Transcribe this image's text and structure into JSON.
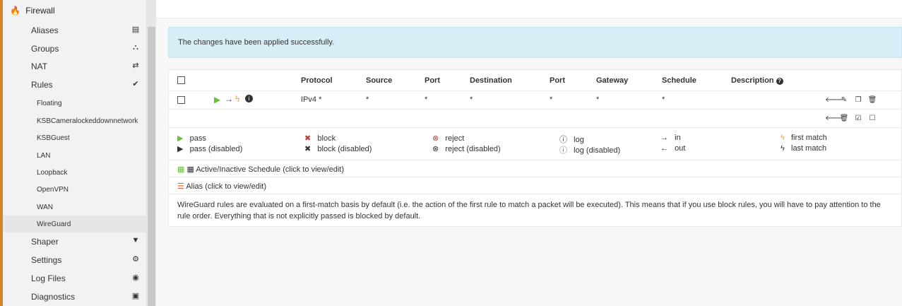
{
  "sidebar": {
    "section": "Firewall",
    "items": [
      {
        "label": "Aliases",
        "icon": "table-icon"
      },
      {
        "label": "Groups",
        "icon": "sitemap-icon"
      },
      {
        "label": "NAT",
        "icon": "exchange-icon"
      },
      {
        "label": "Rules",
        "icon": "check-icon"
      }
    ],
    "subitems": [
      "Floating",
      "KSBCameralockeddownnetwork",
      "KSBGuest",
      "LAN",
      "Loopback",
      "OpenVPN",
      "WAN",
      "WireGuard"
    ],
    "bottom_items": [
      {
        "label": "Shaper",
        "icon": "filter-icon"
      },
      {
        "label": "Settings",
        "icon": "cogs-icon"
      },
      {
        "label": "Log Files",
        "icon": "eye-icon"
      },
      {
        "label": "Diagnostics",
        "icon": "medkit-icon"
      }
    ]
  },
  "alert": {
    "message": "The changes have been applied successfully."
  },
  "table": {
    "headers": [
      "Protocol",
      "Source",
      "Port",
      "Destination",
      "Port",
      "Gateway",
      "Schedule",
      "Description"
    ],
    "rule": {
      "protocol": "IPv4 *",
      "source": "*",
      "src_port": "*",
      "destination": "*",
      "dst_port": "*",
      "gateway": "*",
      "schedule": "*"
    }
  },
  "legend": {
    "pass": "pass",
    "pass_disabled": "pass (disabled)",
    "block": "block",
    "block_disabled": "block (disabled)",
    "reject": "reject",
    "reject_disabled": "reject (disabled)",
    "log": "log",
    "log_disabled": "log (disabled)",
    "in": "in",
    "out": "out",
    "first_match": "first match",
    "last_match": "last match"
  },
  "notes": {
    "schedule": "Active/Inactive Schedule (click to view/edit)",
    "alias": "Alias (click to view/edit)",
    "info": "WireGuard rules are evaluated on a first-match basis by default (i.e. the action of the first rule to match a packet will be executed). This means that if you use block rules, you will have to pay attention to the rule order. Everything that is not explicitly passed is blocked by default."
  },
  "colors": {
    "accent": "#d9822b",
    "alert_bg": "#d9edf7",
    "pass_green": "#6cbf3a",
    "block_red": "#c0392b",
    "match_orange": "#f0a030"
  }
}
